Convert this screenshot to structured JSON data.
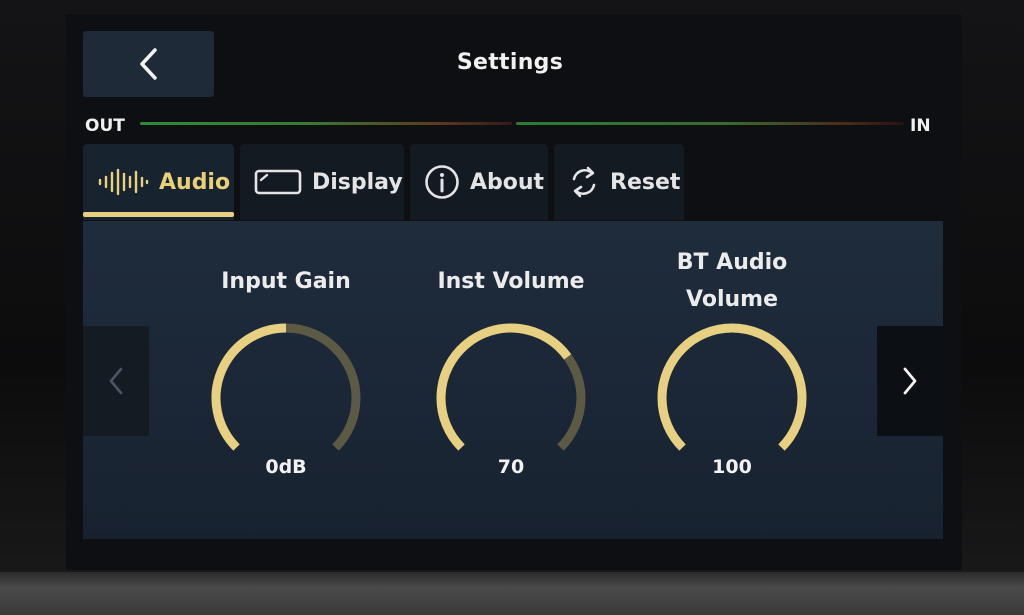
{
  "header": {
    "title": "Settings",
    "back_icon": "chevron-left-icon"
  },
  "meter": {
    "out_label": "OUT",
    "in_label": "IN"
  },
  "tabs": [
    {
      "label": "Audio",
      "icon": "waveform-icon",
      "active": true
    },
    {
      "label": "Display",
      "icon": "display-icon",
      "active": false
    },
    {
      "label": "About",
      "icon": "info-icon",
      "active": false
    },
    {
      "label": "Reset",
      "icon": "reset-icon",
      "active": false
    }
  ],
  "knobs": [
    {
      "title": "Input Gain",
      "value": "0dB",
      "level": 0.5
    },
    {
      "title": "Inst Volume",
      "value": "70",
      "level": 0.7
    },
    {
      "title": "BT Audio Volume",
      "title_line1": "BT Audio",
      "title_line2": "Volume",
      "value": "100",
      "level": 1.0
    }
  ],
  "colors": {
    "accent": "#e8d082",
    "knob_track": "#5c5a45",
    "panel": "#1c2837"
  },
  "nav": {
    "prev_icon": "chevron-left-icon",
    "next_icon": "chevron-right-icon"
  }
}
